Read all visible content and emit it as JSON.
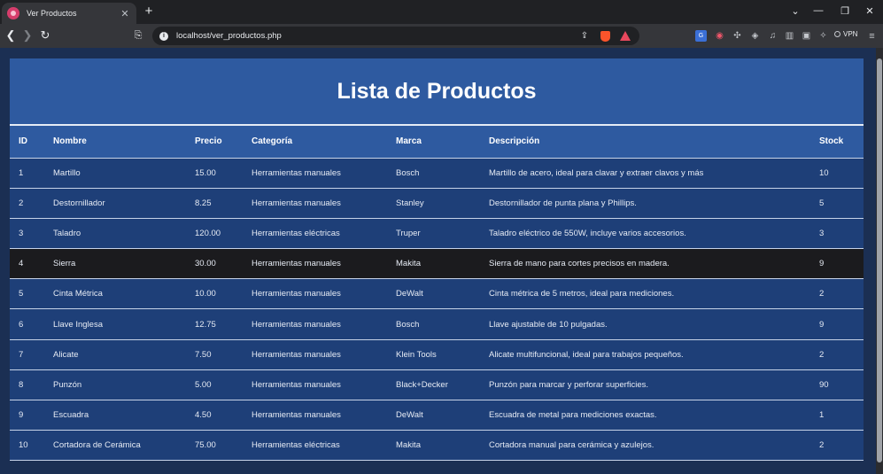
{
  "browser": {
    "tab_title": "Ver Productos",
    "tab_close": "✕",
    "new_tab": "+",
    "url": "localhost/ver_productos.php",
    "vpn_label": "VPN",
    "win_min": "—",
    "win_restore": "❐",
    "win_close": "✕",
    "chevron": "⌄",
    "icons": [
      "back-icon",
      "forward-icon",
      "reload-icon",
      "bookmark-icon",
      "info-icon",
      "share-icon",
      "brave-shield-icon",
      "brave-rewards-icon",
      "extensions-icon",
      "menu-icon"
    ]
  },
  "page": {
    "title": "Lista de Productos",
    "colors": {
      "header": "#2e5aa0",
      "row": "#1e3f78",
      "highlight_row": "#1b1b1e",
      "background": "#1b2f53"
    }
  },
  "table": {
    "headers": {
      "id": "ID",
      "nombre": "Nombre",
      "precio": "Precio",
      "categoria": "Categoría",
      "marca": "Marca",
      "descripcion": "Descripción",
      "stock": "Stock"
    },
    "rows": [
      {
        "id": "1",
        "nombre": "Martillo",
        "precio": "15.00",
        "categoria": "Herramientas manuales",
        "marca": "Bosch",
        "descripcion": "Martillo de acero, ideal para clavar y extraer clavos y más",
        "stock": "10"
      },
      {
        "id": "2",
        "nombre": "Destornillador",
        "precio": "8.25",
        "categoria": "Herramientas manuales",
        "marca": "Stanley",
        "descripcion": "Destornillador de punta plana y Phillips.",
        "stock": "5"
      },
      {
        "id": "3",
        "nombre": "Taladro",
        "precio": "120.00",
        "categoria": "Herramientas eléctricas",
        "marca": "Truper",
        "descripcion": "Taladro eléctrico de 550W, incluye varios accesorios.",
        "stock": "3"
      },
      {
        "id": "4",
        "nombre": "Sierra",
        "precio": "30.00",
        "categoria": "Herramientas manuales",
        "marca": "Makita",
        "descripcion": "Sierra de mano para cortes precisos en madera.",
        "stock": "9"
      },
      {
        "id": "5",
        "nombre": "Cinta Métrica",
        "precio": "10.00",
        "categoria": "Herramientas manuales",
        "marca": "DeWalt",
        "descripcion": "Cinta métrica de 5 metros, ideal para mediciones.",
        "stock": "2"
      },
      {
        "id": "6",
        "nombre": "Llave Inglesa",
        "precio": "12.75",
        "categoria": "Herramientas manuales",
        "marca": "Bosch",
        "descripcion": "Llave ajustable de 10 pulgadas.",
        "stock": "9"
      },
      {
        "id": "7",
        "nombre": "Alicate",
        "precio": "7.50",
        "categoria": "Herramientas manuales",
        "marca": "Klein Tools",
        "descripcion": "Alicate multifuncional, ideal para trabajos pequeños.",
        "stock": "2"
      },
      {
        "id": "8",
        "nombre": "Punzón",
        "precio": "5.00",
        "categoria": "Herramientas manuales",
        "marca": "Black+Decker",
        "descripcion": "Punzón para marcar y perforar superficies.",
        "stock": "90"
      },
      {
        "id": "9",
        "nombre": "Escuadra",
        "precio": "4.50",
        "categoria": "Herramientas manuales",
        "marca": "DeWalt",
        "descripcion": "Escuadra de metal para mediciones exactas.",
        "stock": "1"
      },
      {
        "id": "10",
        "nombre": "Cortadora de Cerámica",
        "precio": "75.00",
        "categoria": "Herramientas eléctricas",
        "marca": "Makita",
        "descripcion": "Cortadora manual para cerámica y azulejos.",
        "stock": "2"
      }
    ]
  }
}
